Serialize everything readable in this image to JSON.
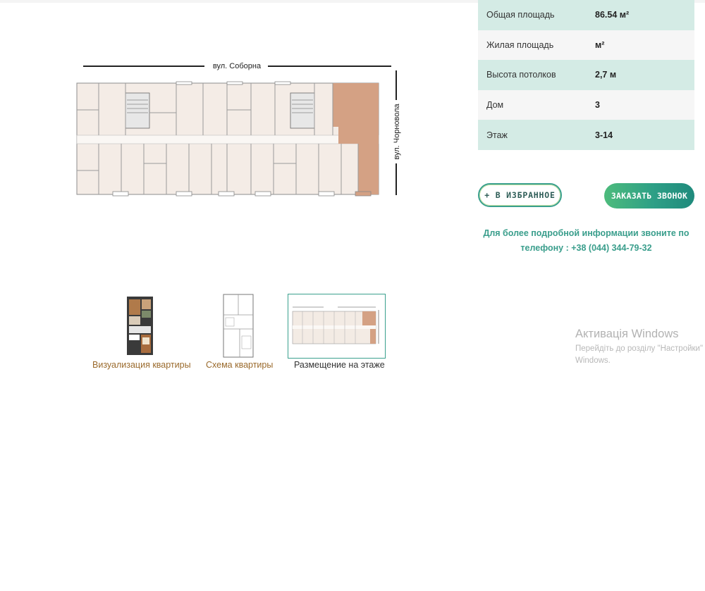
{
  "specs": [
    {
      "label": "Общая площадь",
      "value": "86.54 м²"
    },
    {
      "label": "Жилая площадь",
      "value": "м²"
    },
    {
      "label": "Высота потолков",
      "value": "2,7 м"
    },
    {
      "label": "Дом",
      "value": "3"
    },
    {
      "label": "Этаж",
      "value": "3-14"
    }
  ],
  "plan": {
    "street_top": "вул. Соборна",
    "street_side": "вул. Чорновола"
  },
  "buttons": {
    "favorite": "+ В ИЗБРАННОЕ",
    "call": "ЗАКАЗАТЬ ЗВОНОК"
  },
  "info": {
    "text": "Для более подробной информации звоните по телефону :",
    "phone": "+38 (044) 344-79-32"
  },
  "thumbnails": [
    {
      "caption": "Визуализация квартиры"
    },
    {
      "caption": "Схема квартиры"
    },
    {
      "caption": "Размещение на этаже"
    }
  ],
  "watermark": {
    "title": "Активація Windows",
    "line1": "Перейдіть до розділу \"Настройки\"",
    "line2": "Windows."
  },
  "colors": {
    "accent_teal": "#3aa08e",
    "spec_row_tint": "#d4ebe5",
    "highlight_apartment": "#d4a184",
    "caption_brown": "#9a6a2c"
  }
}
